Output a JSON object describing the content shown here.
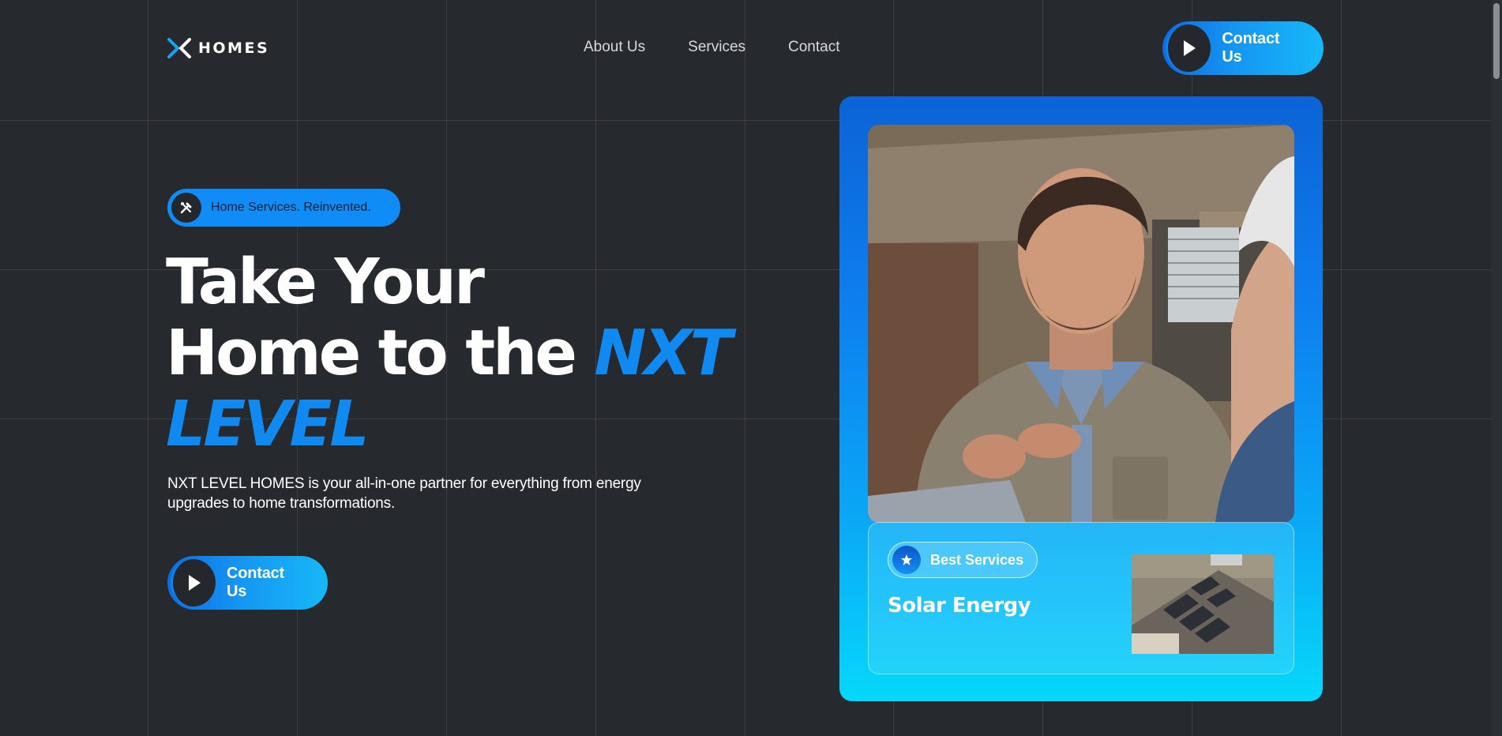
{
  "brand": {
    "name": "HOMES",
    "logo_icon": "x-arrow-logo",
    "accent": "#0f8cf5",
    "background": "#26292e"
  },
  "nav": {
    "items": [
      {
        "label": "About Us"
      },
      {
        "label": "Services"
      },
      {
        "label": "Contact"
      }
    ]
  },
  "header_cta": {
    "label": "Contact Us",
    "icon": "cursor-arrow-icon"
  },
  "hero": {
    "badge_icon": "tools-icon",
    "badge_text": "Home Services. Reinvented.",
    "headline_line1": "Take Your",
    "headline_line2": "Home to the ",
    "headline_accent1": "NXT",
    "headline_accent2": "LEVEL",
    "description": "NXT LEVEL HOMES is your all-in-one partner for everything from energy upgrades to home transformations.",
    "cta_label": "Contact Us"
  },
  "card": {
    "photo_alt": "photo-contractor-talking-to-homeowner",
    "pill_icon": "star-icon",
    "pill_label": "Best Services",
    "service_title": "Solar Energy",
    "thumb_alt": "photo-solar-panels-on-roof"
  }
}
